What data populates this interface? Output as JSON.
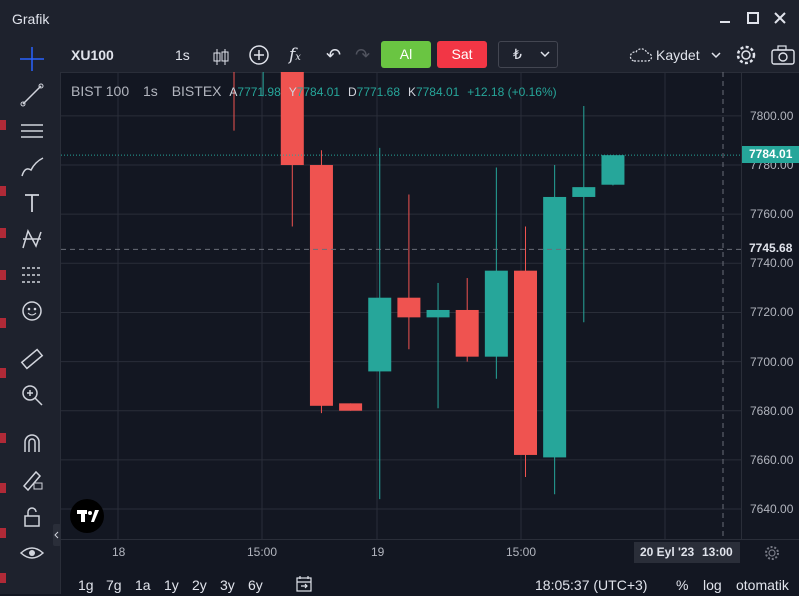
{
  "window": {
    "title": "Grafik",
    "min_icon": "minimize-icon",
    "max_icon": "maximize-icon",
    "close_icon": "close-icon"
  },
  "toolbar": {
    "symbol": "XU100",
    "interval": "1s",
    "buy_label": "Al",
    "sell_label": "Sat",
    "currency": "₺",
    "save_label": "Kaydet"
  },
  "legend": {
    "symbol_name": "BIST 100",
    "interval": "1s",
    "exchange": "BISTEX",
    "open_prefix": "A",
    "open": "7771.98",
    "high_prefix": "Y",
    "high": "7784.01",
    "low_prefix": "D",
    "low": "7771.68",
    "close_prefix": "K",
    "close": "7784.01",
    "change": "+12.18 (+0.16%)"
  },
  "price_tags": {
    "last": "7784.01",
    "crosshair": "7745.68"
  },
  "time_tag": {
    "date": "20 Eyl '23",
    "time": "13:00"
  },
  "bottom": {
    "ranges": [
      "1g",
      "7g",
      "1a",
      "1y",
      "2y",
      "3y",
      "6y"
    ],
    "clock": "18:05:37 (UTC+3)",
    "percent": "%",
    "log": "log",
    "auto": "otomatik"
  },
  "colors": {
    "up": "#26a69a",
    "down": "#ef5350",
    "background": "#131722",
    "panel": "#1e222d",
    "buy": "#6ac542",
    "sell": "#f23645"
  },
  "chart_data": {
    "type": "candlestick",
    "y_ticks": [
      7640,
      7660,
      7680,
      7700,
      7720,
      7740,
      7760,
      7780,
      7800
    ],
    "x_ticks": [
      "18",
      "15:00",
      "19",
      "15:00",
      "20"
    ],
    "ylim": [
      7632,
      7822
    ],
    "candles": [
      {
        "o": 7828,
        "h": 7830,
        "l": 7794,
        "c": 7818
      },
      {
        "o": 7818,
        "h": 7828,
        "l": 7808,
        "c": 7826
      },
      {
        "o": 7828,
        "h": 7830,
        "l": 7755,
        "c": 7780
      },
      {
        "o": 7780,
        "h": 7786,
        "l": 7679,
        "c": 7682
      },
      {
        "o": 7683,
        "h": 7683,
        "l": 7680,
        "c": 7680
      },
      {
        "o": 7696,
        "h": 7787,
        "l": 7644,
        "c": 7726
      },
      {
        "o": 7726,
        "h": 7768,
        "l": 7705,
        "c": 7718
      },
      {
        "o": 7718,
        "h": 7732,
        "l": 7681,
        "c": 7721
      },
      {
        "o": 7721,
        "h": 7734,
        "l": 7700,
        "c": 7702
      },
      {
        "o": 7702,
        "h": 7779,
        "l": 7693,
        "c": 7737
      },
      {
        "o": 7737,
        "h": 7755,
        "l": 7653,
        "c": 7662
      },
      {
        "o": 7661,
        "h": 7780,
        "l": 7646,
        "c": 7767
      },
      {
        "o": 7767,
        "h": 7804,
        "l": 7716,
        "c": 7771
      },
      {
        "o": 7771.98,
        "h": 7784.01,
        "l": 7771.68,
        "c": 7784.01
      }
    ]
  }
}
